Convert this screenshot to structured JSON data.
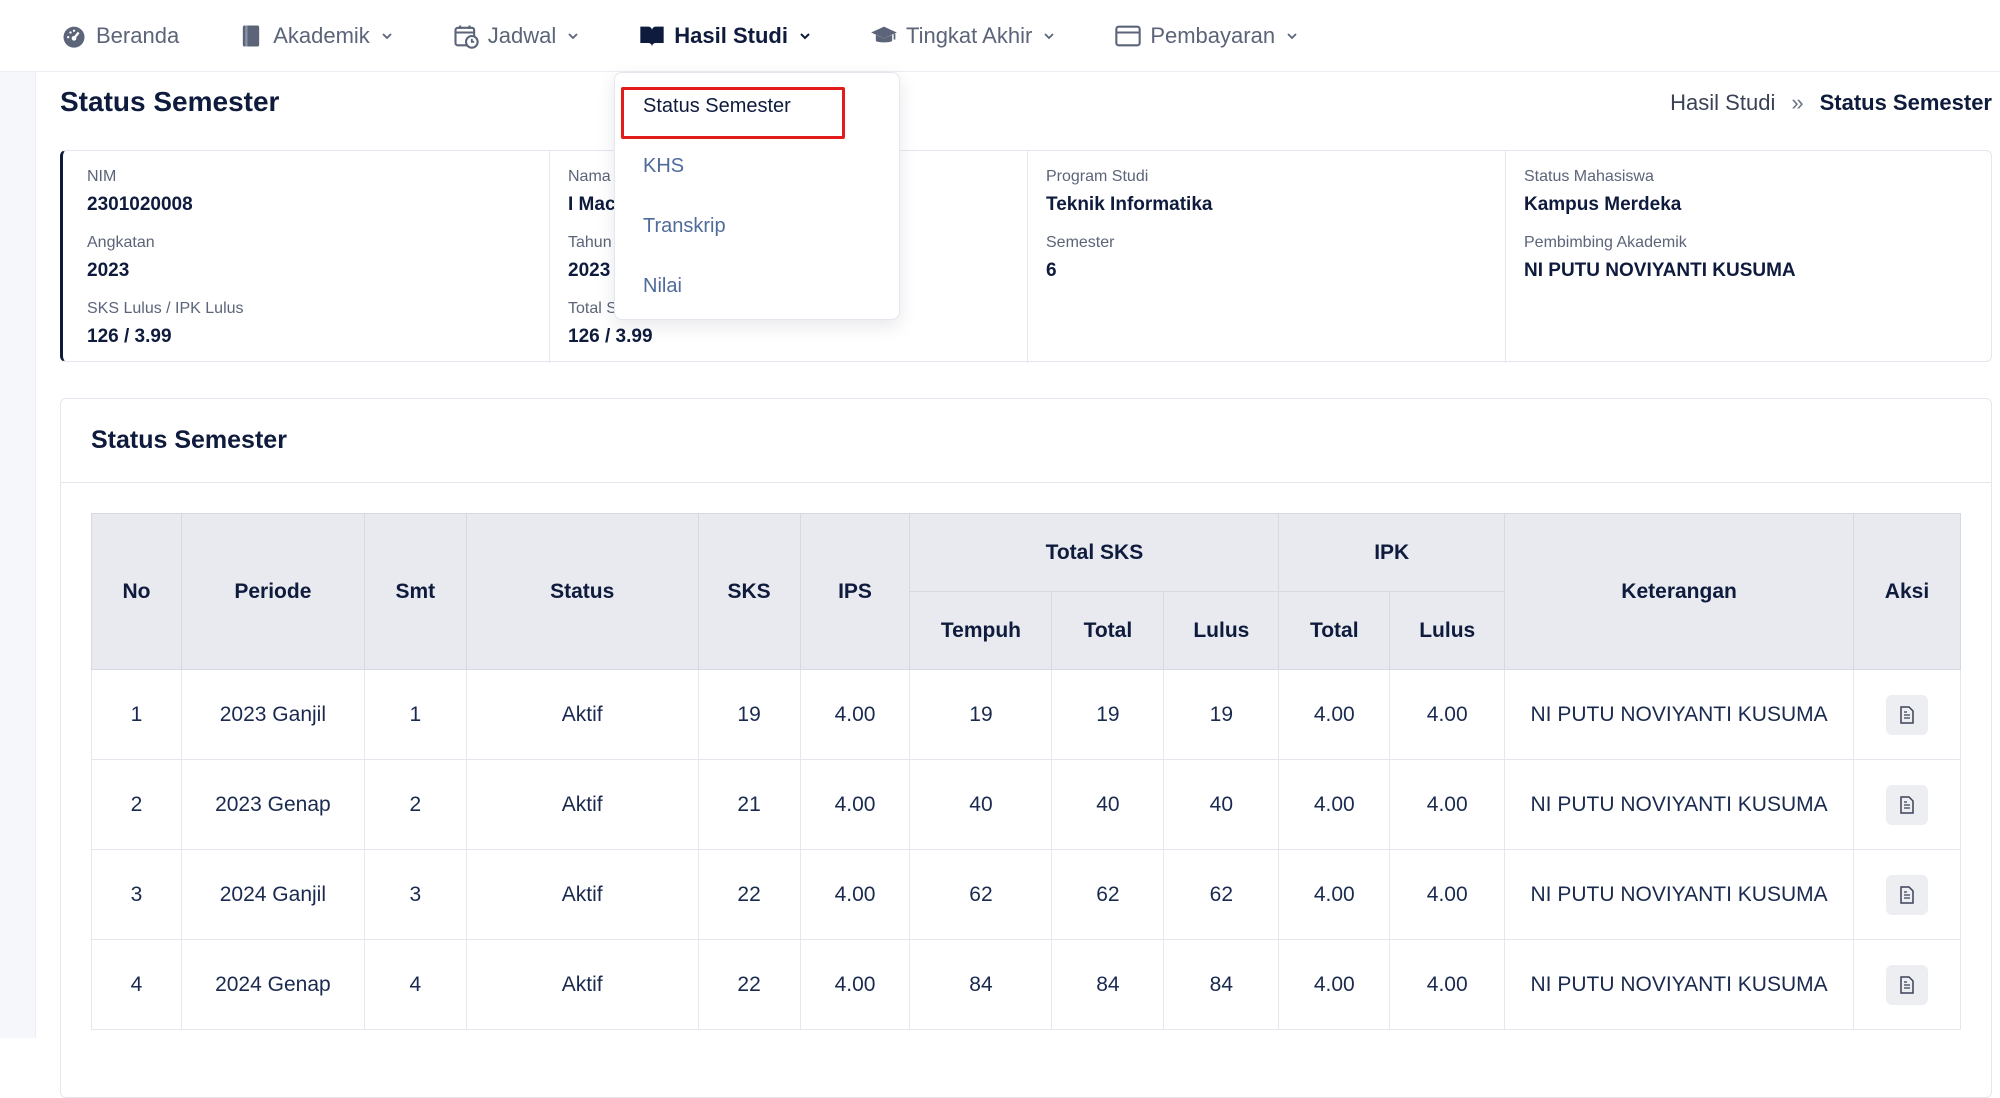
{
  "nav": {
    "items": [
      {
        "label": "Beranda",
        "icon": "dashboard-icon",
        "dropdown": false
      },
      {
        "label": "Akademik",
        "icon": "book-icon",
        "dropdown": true
      },
      {
        "label": "Jadwal",
        "icon": "calendar-clock-icon",
        "dropdown": true
      },
      {
        "label": "Hasil Studi",
        "icon": "open-book-icon",
        "dropdown": true,
        "active": true
      },
      {
        "label": "Tingkat Akhir",
        "icon": "graduation-cap-icon",
        "dropdown": true
      },
      {
        "label": "Pembayaran",
        "icon": "card-icon",
        "dropdown": true
      }
    ]
  },
  "dropdown": {
    "items": [
      "Status Semester",
      "KHS",
      "Transkrip",
      "Nilai"
    ],
    "selected": "Status Semester",
    "highlight_color": "#e21b1b"
  },
  "page": {
    "title": "Status Semester",
    "breadcrumb": {
      "parent": "Hasil Studi",
      "separator": "»",
      "current": "Status Semester"
    }
  },
  "info": {
    "col1": [
      {
        "label": "NIM",
        "value": "2301020008"
      },
      {
        "label": "Angkatan",
        "value": "2023"
      },
      {
        "label": "SKS Lulus / IPK Lulus",
        "value": "126 / 3.99"
      }
    ],
    "col2": [
      {
        "label": "Nama",
        "value": "I Mac"
      },
      {
        "label": "Tahun",
        "value": "2023"
      },
      {
        "label": "Total S",
        "value": "126 / 3.99"
      }
    ],
    "col3": [
      {
        "label": "Program Studi",
        "value": "Teknik Informatika"
      },
      {
        "label": "Semester",
        "value": "6"
      }
    ],
    "col4": [
      {
        "label": "Status Mahasiswa",
        "value": "Kampus Merdeka"
      },
      {
        "label": "Pembimbing Akademik",
        "value": "NI PUTU NOVIYANTI KUSUMA"
      }
    ]
  },
  "panel": {
    "title": "Status Semester",
    "headers": {
      "no": "No",
      "periode": "Periode",
      "smt": "Smt",
      "status": "Status",
      "sks": "SKS",
      "ips": "IPS",
      "total_sks": "Total SKS",
      "ipk": "IPK",
      "keterangan": "Keterangan",
      "aksi": "Aksi",
      "tempuh": "Tempuh",
      "total": "Total",
      "lulus": "Lulus",
      "ipk_total": "Total",
      "ipk_lulus": "Lulus"
    },
    "rows": [
      {
        "no": "1",
        "periode": "2023 Ganjil",
        "smt": "1",
        "status": "Aktif",
        "sks": "19",
        "ips": "4.00",
        "tempuh": "19",
        "total": "19",
        "lulus": "19",
        "ipk_total": "4.00",
        "ipk_lulus": "4.00",
        "keterangan": "NI PUTU NOVIYANTI KUSUMA"
      },
      {
        "no": "2",
        "periode": "2023 Genap",
        "smt": "2",
        "status": "Aktif",
        "sks": "21",
        "ips": "4.00",
        "tempuh": "40",
        "total": "40",
        "lulus": "40",
        "ipk_total": "4.00",
        "ipk_lulus": "4.00",
        "keterangan": "NI PUTU NOVIYANTI KUSUMA"
      },
      {
        "no": "3",
        "periode": "2024 Ganjil",
        "smt": "3",
        "status": "Aktif",
        "sks": "22",
        "ips": "4.00",
        "tempuh": "62",
        "total": "62",
        "lulus": "62",
        "ipk_total": "4.00",
        "ipk_lulus": "4.00",
        "keterangan": "NI PUTU NOVIYANTI KUSUMA"
      },
      {
        "no": "4",
        "periode": "2024 Genap",
        "smt": "4",
        "status": "Aktif",
        "sks": "22",
        "ips": "4.00",
        "tempuh": "84",
        "total": "84",
        "lulus": "84",
        "ipk_total": "4.00",
        "ipk_lulus": "4.00",
        "keterangan": "NI PUTU NOVIYANTI KUSUMA"
      }
    ]
  }
}
